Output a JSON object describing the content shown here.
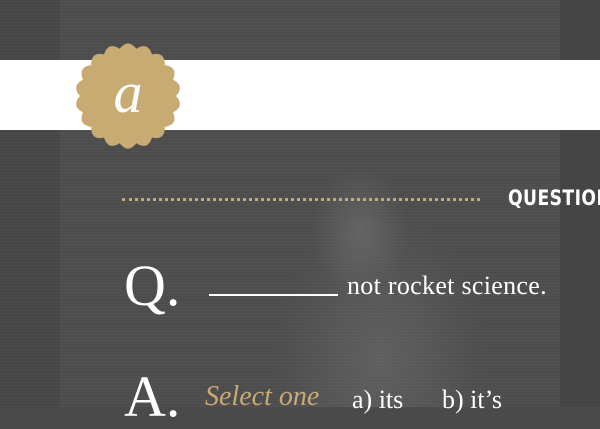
{
  "badge": {
    "letter": "a",
    "color": "#c8aa73"
  },
  "header": {
    "section_label": "QUESTION"
  },
  "question": {
    "prefix": "Q.",
    "text": "not rocket science."
  },
  "answer": {
    "prefix": "A.",
    "prompt": "Select one",
    "options": [
      "a) its",
      "b) it’s"
    ]
  },
  "colors": {
    "accent": "#c8aa73",
    "background": "#4a4a4a",
    "banner": "#ffffff",
    "text": "#ffffff"
  }
}
